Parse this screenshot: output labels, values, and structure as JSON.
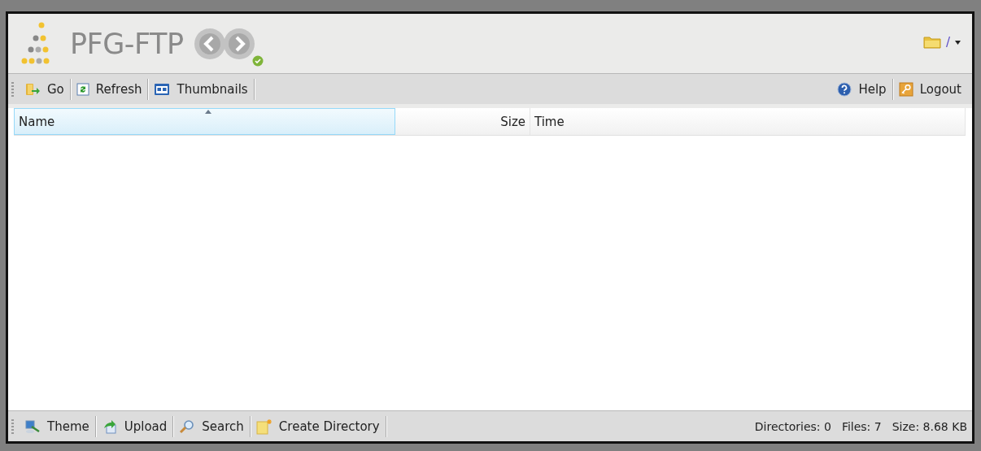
{
  "header": {
    "title": "PFG-FTP",
    "path": "/"
  },
  "toolbar": {
    "left": [
      {
        "label": "Go"
      },
      {
        "label": "Refresh"
      },
      {
        "label": "Thumbnails"
      }
    ],
    "right": [
      {
        "label": "Help"
      },
      {
        "label": "Logout"
      }
    ]
  },
  "table": {
    "columns": [
      {
        "label": "Name",
        "selected": true,
        "kind": "text"
      },
      {
        "label": "Size",
        "selected": false,
        "kind": "number"
      },
      {
        "label": "Time",
        "selected": false,
        "kind": "text"
      }
    ]
  },
  "bottom_toolbar": {
    "left": [
      {
        "label": "Theme"
      },
      {
        "label": "Upload"
      },
      {
        "label": "Search"
      },
      {
        "label": "Create Directory"
      }
    ]
  },
  "status_bar": [
    "Directories: 0",
    "Files: 7",
    "Size: 8.68 KB"
  ]
}
